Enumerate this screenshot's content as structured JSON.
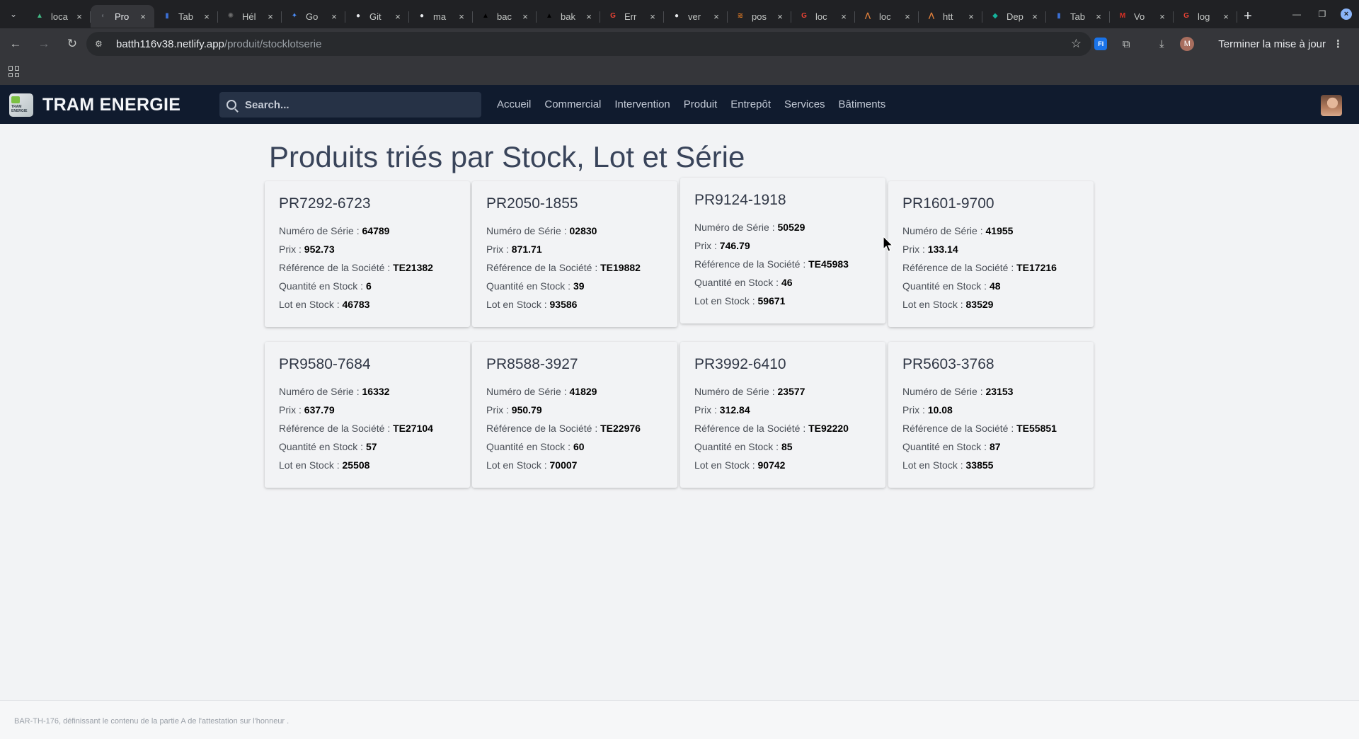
{
  "browser": {
    "tabs": [
      {
        "title": "loca",
        "color": "#41b883",
        "glyph": "▲",
        "active": false
      },
      {
        "title": "Pro",
        "color": "#5f6368",
        "glyph": "◐",
        "active": true
      },
      {
        "title": "Tab",
        "color": "#3b6fd4",
        "glyph": "▮",
        "active": false
      },
      {
        "title": "Hél",
        "color": "#6e6e6e",
        "glyph": "✺",
        "active": false
      },
      {
        "title": "Go",
        "color": "#4b8cf7",
        "glyph": "✦",
        "active": false
      },
      {
        "title": "Git",
        "color": "#e8eaed",
        "glyph": "●",
        "active": false
      },
      {
        "title": "ma",
        "color": "#e8eaed",
        "glyph": "●",
        "active": false
      },
      {
        "title": "bac",
        "color": "#000000",
        "glyph": "▲",
        "active": false
      },
      {
        "title": "bak",
        "color": "#000000",
        "glyph": "▲",
        "active": false
      },
      {
        "title": "Err",
        "color": "#ea4335",
        "glyph": "G",
        "active": false
      },
      {
        "title": "ver",
        "color": "#e8eaed",
        "glyph": "●",
        "active": false
      },
      {
        "title": "pos",
        "color": "#e07b24",
        "glyph": "≋",
        "active": false
      },
      {
        "title": "loc",
        "color": "#ea4335",
        "glyph": "G",
        "active": false
      },
      {
        "title": "loc",
        "color": "#e0803c",
        "glyph": "⋀",
        "active": false
      },
      {
        "title": "htt",
        "color": "#e0803c",
        "glyph": "⋀",
        "active": false
      },
      {
        "title": "Dep",
        "color": "#15b39b",
        "glyph": "◆",
        "active": false
      },
      {
        "title": "Tab",
        "color": "#3b6fd4",
        "glyph": "▮",
        "active": false
      },
      {
        "title": "Vo",
        "color": "#d93025",
        "glyph": "M",
        "active": false
      },
      {
        "title": "log",
        "color": "#ea4335",
        "glyph": "G",
        "active": false
      }
    ],
    "url_host": "batth116v38.netlify.app",
    "url_path": "/produit/stocklotserie",
    "update_label": "Terminer la mise à jour",
    "profile_initial": "M",
    "extension_label": "FI"
  },
  "header": {
    "brand": "TRAM ENERGIE",
    "logo_text": "TRAM ENERGIE",
    "search_placeholder": "Search...",
    "nav": [
      "Accueil",
      "Commercial",
      "Intervention",
      "Produit",
      "Entrepôt",
      "Services",
      "Bâtiments"
    ]
  },
  "page": {
    "title": "Produits triés par Stock, Lot et Série",
    "labels": {
      "serial": "Numéro de Série : ",
      "price": "Prix : ",
      "ref": "Référence de la Société : ",
      "qty": "Quantité en Stock : ",
      "lot": "Lot en Stock : "
    },
    "products": [
      {
        "code": "PR7292-6723",
        "serial": "64789",
        "price": "952.73",
        "ref": "TE21382",
        "qty": "6",
        "lot": "46783"
      },
      {
        "code": "PR2050-1855",
        "serial": "02830",
        "price": "871.71",
        "ref": "TE19882",
        "qty": "39",
        "lot": "93586"
      },
      {
        "code": "PR9124-1918",
        "serial": "50529",
        "price": "746.79",
        "ref": "TE45983",
        "qty": "46",
        "lot": "59671"
      },
      {
        "code": "PR1601-9700",
        "serial": "41955",
        "price": "133.14",
        "ref": "TE17216",
        "qty": "48",
        "lot": "83529"
      },
      {
        "code": "PR9580-7684",
        "serial": "16332",
        "price": "637.79",
        "ref": "TE27104",
        "qty": "57",
        "lot": "25508"
      },
      {
        "code": "PR8588-3927",
        "serial": "41829",
        "price": "950.79",
        "ref": "TE22976",
        "qty": "60",
        "lot": "70007"
      },
      {
        "code": "PR3992-6410",
        "serial": "23577",
        "price": "312.84",
        "ref": "TE92220",
        "qty": "85",
        "lot": "90742"
      },
      {
        "code": "PR5603-3768",
        "serial": "23153",
        "price": "10.08",
        "ref": "TE55851",
        "qty": "87",
        "lot": "33855"
      }
    ]
  },
  "footer": {
    "text": "BAR-TH-176, définissant le contenu de la partie A de l'attestation sur l'honneur ."
  }
}
